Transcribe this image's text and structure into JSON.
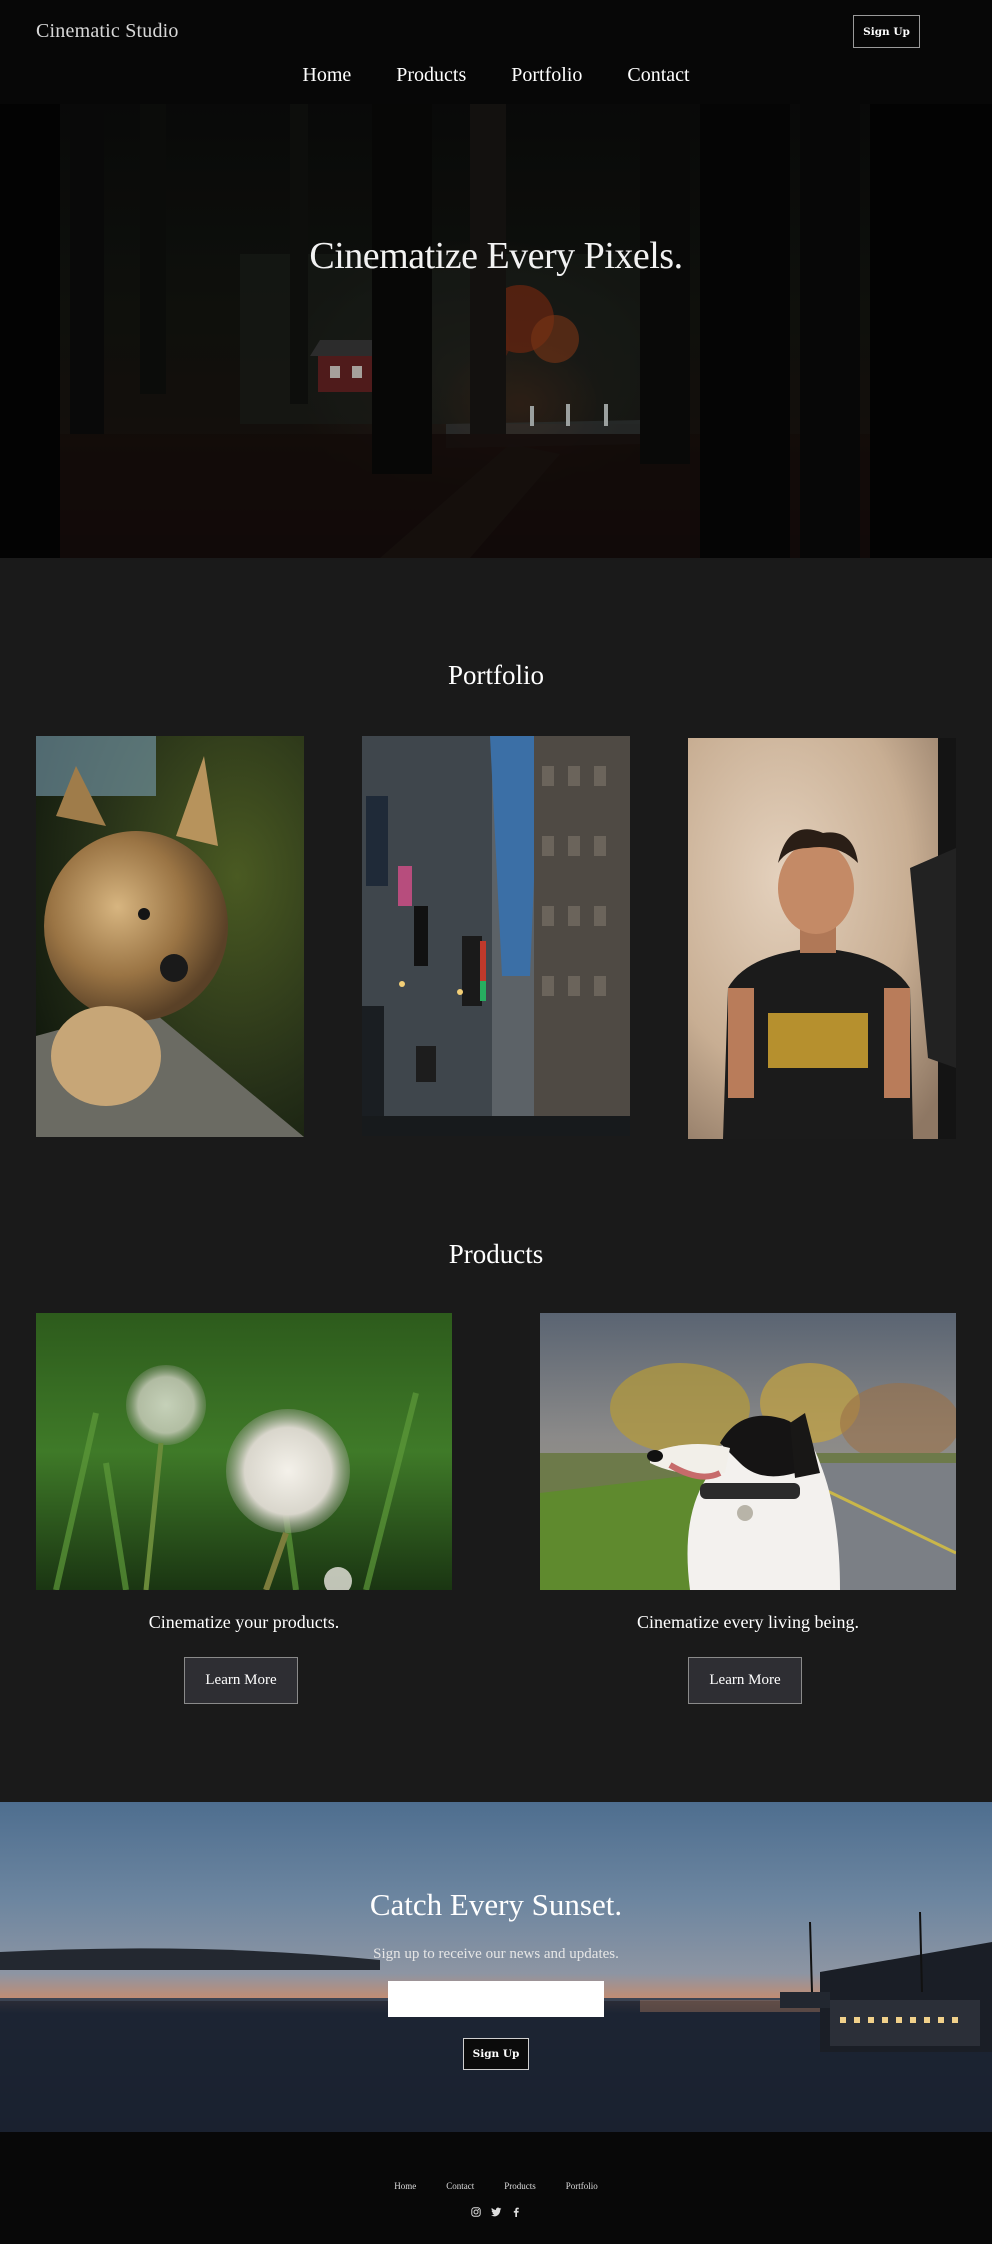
{
  "header": {
    "brand": "Cinematic Studio",
    "signup_label": "Sign Up",
    "nav": [
      "Home",
      "Products",
      "Portfolio",
      "Contact"
    ]
  },
  "hero": {
    "title": "Cinematize Every Pixels."
  },
  "portfolio": {
    "title": "Portfolio",
    "images": [
      {
        "subject": "yorkshire-terrier-photo"
      },
      {
        "subject": "city-building-alley-photo"
      },
      {
        "subject": "man-portrait-photo"
      }
    ]
  },
  "products": {
    "title": "Products",
    "items": [
      {
        "caption": "Cinematize your products.",
        "button": "Learn More",
        "image": "dandelion-photo"
      },
      {
        "caption": "Cinematize every living being.",
        "button": "Learn More",
        "image": "dog-portrait-photo"
      }
    ]
  },
  "cta": {
    "title": "Catch Every Sunset.",
    "subtitle": "Sign up to receive our news and updates.",
    "input_placeholder": "",
    "button": "Sign Up"
  },
  "footer": {
    "links": [
      "Home",
      "Contact",
      "Products",
      "Portfolio"
    ],
    "icons": [
      "instagram-icon",
      "twitter-icon",
      "facebook-icon"
    ]
  },
  "colors": {
    "page_bg": "#1a1a1a",
    "header_bg": "#070707",
    "button_bg": "#2e2e33",
    "footer_bg": "#080808"
  }
}
